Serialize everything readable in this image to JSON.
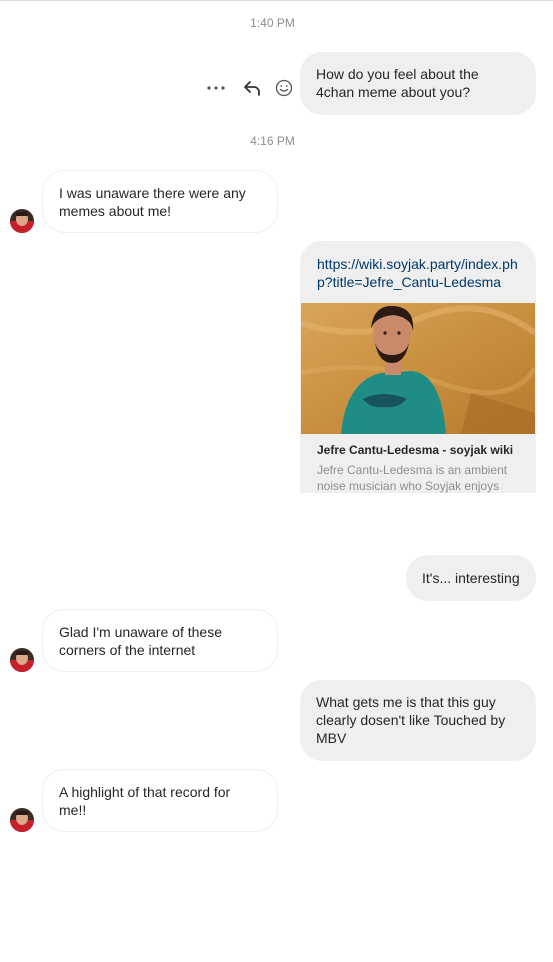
{
  "timestamps": [
    "1:40 PM",
    "4:16 PM"
  ],
  "messages": [
    {
      "side": "sent",
      "text": "How do you feel about the 4chan meme about you?"
    },
    {
      "side": "received",
      "text": "I was unaware there were any memes about me!"
    },
    {
      "side": "sent",
      "type": "link",
      "url": "https://wiki.soyjak.party/index.php?title=Jefre_Cantu-Ledesma",
      "link_title": "Jefre Cantu-Ledesma - soyjak wiki",
      "link_description": "Jefre Cantu-Ledesma is an ambient noise musician who Soyjak enjoys"
    },
    {
      "side": "sent",
      "text": "It's... interesting"
    },
    {
      "side": "received",
      "text": "Glad I'm unaware of these corners of the internet"
    },
    {
      "side": "sent",
      "text": "What gets me is that this guy clearly dosen't like Touched by MBV"
    },
    {
      "side": "received",
      "text": "A highlight of that record for me!!"
    }
  ],
  "message_actions": {
    "icons": [
      "more-icon",
      "reply-icon",
      "emoji-icon"
    ]
  },
  "colors": {
    "sent_bubble": "#efefef",
    "received_border": "#efefef",
    "link": "#00376b",
    "timestamp": "#8e8e8e"
  }
}
